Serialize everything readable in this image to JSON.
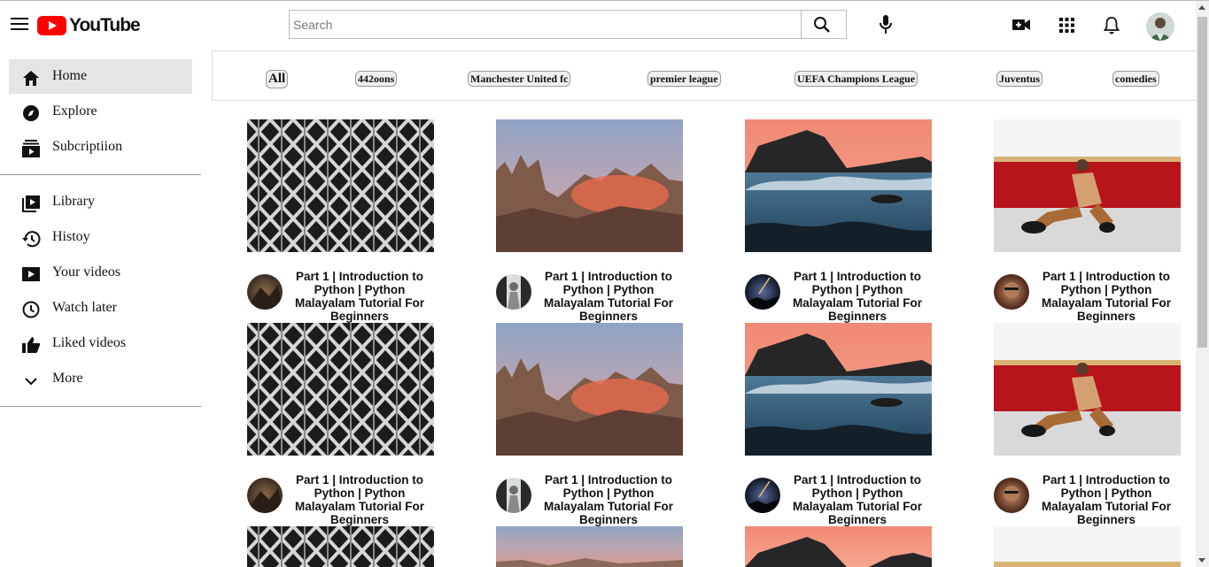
{
  "header": {
    "logo_text": "YouTube",
    "search_placeholder": "Search",
    "icons": [
      "menu-icon",
      "search-icon",
      "mic-icon",
      "create-video-icon",
      "apps-grid-icon",
      "bell-icon",
      "avatar"
    ]
  },
  "sidebar": {
    "items": [
      {
        "label": "Home",
        "icon": "home-icon",
        "active": true
      },
      {
        "label": "Explore",
        "icon": "compass-icon"
      },
      {
        "label": "Subcriptiion",
        "icon": "subscriptions-icon"
      },
      {
        "label": "Library",
        "icon": "library-icon"
      },
      {
        "label": "Histoy",
        "icon": "history-icon"
      },
      {
        "label": "Your videos",
        "icon": "play-icon"
      },
      {
        "label": "Watch later",
        "icon": "clock-icon"
      },
      {
        "label": "Liked videos",
        "icon": "thumbs-up-icon"
      },
      {
        "label": "More",
        "icon": "chevron-down-icon"
      }
    ]
  },
  "chips": [
    "All",
    "442oons",
    "Manchester United fc",
    "premier league",
    "UEFA Champions League",
    "Juventus",
    "comedies"
  ],
  "videos": [
    {
      "title": "Part 1 | Introduction to Python | Python Malayalam Tutorial For Beginners",
      "thumb": "architecture-thumbnail",
      "avatar": "rock-avatar"
    },
    {
      "title": "Part 1 | Introduction to Python | Python Malayalam Tutorial For Beginners",
      "thumb": "mountain-thumbnail",
      "avatar": "person-avatar"
    },
    {
      "title": "Part 1 | Introduction to Python | Python Malayalam Tutorial For Beginners",
      "thumb": "ocean-thumbnail",
      "avatar": "night-sky-avatar"
    },
    {
      "title": "Part 1 | Introduction to Python | Python Malayalam Tutorial For Beginners",
      "thumb": "man-sitting-thumbnail",
      "avatar": "portrait-avatar"
    },
    {
      "title": "Part 1 | Introduction to Python | Python Malayalam Tutorial For Beginners",
      "thumb": "architecture-thumbnail",
      "avatar": "rock-avatar"
    },
    {
      "title": "Part 1 | Introduction to Python | Python Malayalam Tutorial For Beginners",
      "thumb": "mountain-thumbnail",
      "avatar": "person-avatar"
    },
    {
      "title": "Part 1 | Introduction to Python | Python Malayalam Tutorial For Beginners",
      "thumb": "ocean-thumbnail",
      "avatar": "night-sky-avatar"
    },
    {
      "title": "Part 1 | Introduction to Python | Python Malayalam Tutorial For Beginners",
      "thumb": "man-sitting-thumbnail",
      "avatar": "portrait-avatar"
    }
  ],
  "colors": {
    "brand_red": "#ff0000",
    "active_bg": "#e5e5e5"
  }
}
